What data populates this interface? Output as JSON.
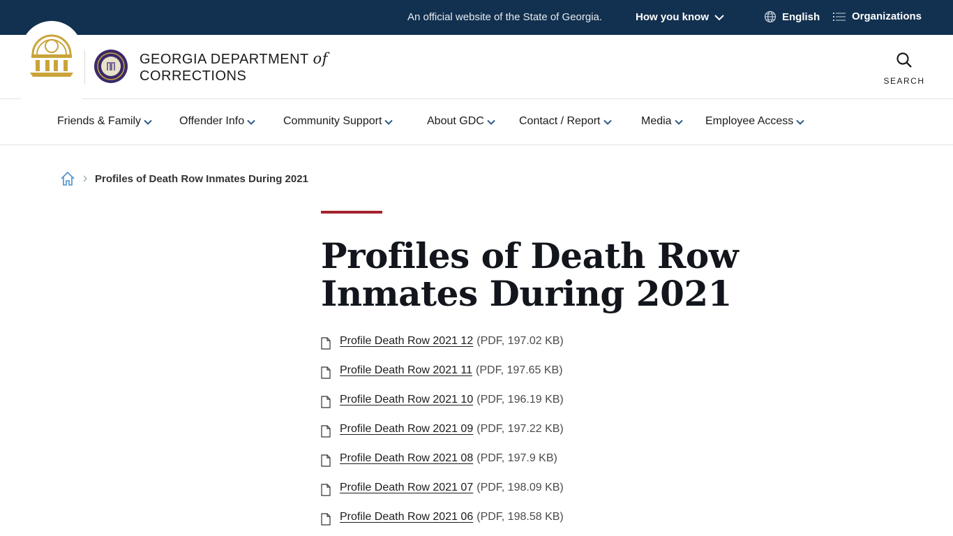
{
  "banner": {
    "official_text": "An official website of the State of Georgia.",
    "how_you_know": "How you know",
    "language": "English",
    "organizations": "Organizations"
  },
  "header": {
    "title_line1": "GEORGIA DEPARTMENT",
    "title_of": "of",
    "title_line2": "CORRECTIONS",
    "search_label": "SEARCH"
  },
  "nav": {
    "items": [
      {
        "label": "Friends & Family"
      },
      {
        "label": "Offender Info"
      },
      {
        "label": "Community Support"
      },
      {
        "label": "About GDC"
      },
      {
        "label": "Contact / Report"
      },
      {
        "label": "Media"
      },
      {
        "label": "Employee Access"
      }
    ]
  },
  "breadcrumb": {
    "current": "Profiles of Death Row Inmates During 2021"
  },
  "page": {
    "title": "Profiles of Death Row Inmates During 2021"
  },
  "documents": [
    {
      "name": "Profile Death Row 2021 12",
      "meta": "(PDF, 197.02 KB)"
    },
    {
      "name": "Profile Death Row 2021 11",
      "meta": "(PDF, 197.65 KB)"
    },
    {
      "name": "Profile Death Row 2021 10",
      "meta": "(PDF, 196.19 KB)"
    },
    {
      "name": "Profile Death Row 2021 09",
      "meta": "(PDF, 197.22 KB)"
    },
    {
      "name": "Profile Death Row 2021 08",
      "meta": "(PDF, 197.9 KB)"
    },
    {
      "name": "Profile Death Row 2021 07",
      "meta": "(PDF, 198.09 KB)"
    },
    {
      "name": "Profile Death Row 2021 06",
      "meta": "(PDF, 198.58 KB)"
    }
  ],
  "colors": {
    "banner_bg": "#12304f",
    "accent_red": "#a4232e",
    "seal_gold": "#c9a43a",
    "seal_purple": "#3a2a6b",
    "link_blue": "#4a90c8"
  }
}
